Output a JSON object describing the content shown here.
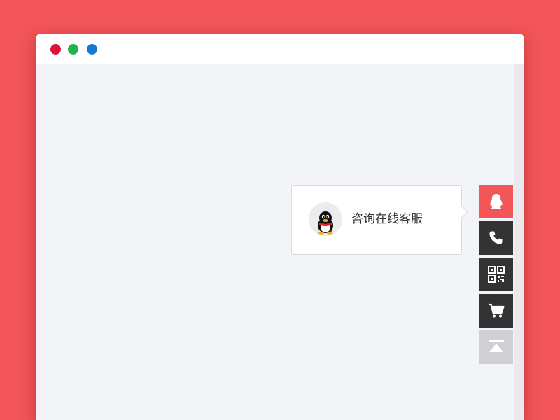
{
  "window": {
    "controls": [
      {
        "name": "close",
        "color": "#e0113a"
      },
      {
        "name": "minimize",
        "color": "#1fb34a"
      },
      {
        "name": "maximize",
        "color": "#1379d1"
      }
    ]
  },
  "popup": {
    "label": "咨询在线客服",
    "avatar_icon": "qq-penguin-icon"
  },
  "sidebar": {
    "items": [
      {
        "name": "qq",
        "icon": "qq-penguin-icon",
        "bg": "#f35658",
        "active": true
      },
      {
        "name": "phone",
        "icon": "phone-icon",
        "bg": "#333333",
        "active": false
      },
      {
        "name": "qrcode",
        "icon": "qr-code-icon",
        "bg": "#333333",
        "active": false
      },
      {
        "name": "cart",
        "icon": "cart-icon",
        "bg": "#333333",
        "active": false
      },
      {
        "name": "back-to-top",
        "icon": "back-to-top-icon",
        "bg": "#d0d0d4",
        "active": false
      }
    ]
  },
  "colors": {
    "background": "#f35658",
    "content": "#f3f4f8",
    "accent": "#f35658",
    "dark": "#333333"
  }
}
